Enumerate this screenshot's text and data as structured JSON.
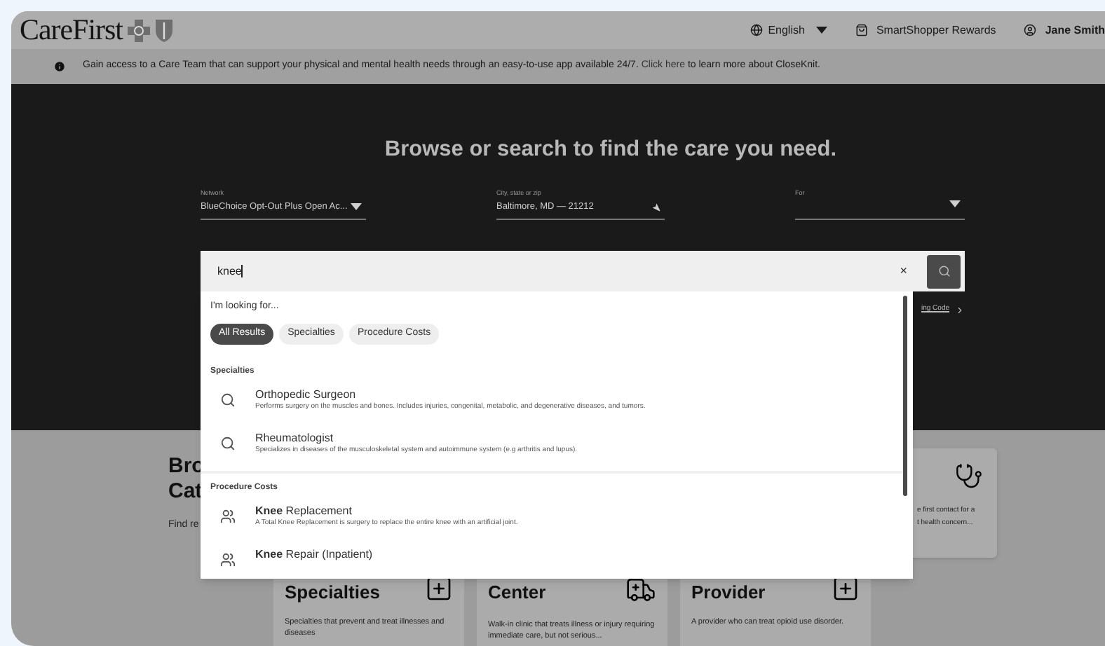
{
  "header": {
    "logo": "CareFirst",
    "language": "English",
    "rewards": "SmartShopper Rewards",
    "user": "Jane Smith"
  },
  "banner": {
    "text": "Gain access to a Care Team that can support your physical and mental health needs through an easy-to-use app available 24/7.",
    "link": "Click here",
    "text_after": "to learn more about CloseKnit."
  },
  "hero": {
    "title": "Browse or search to find the care you need.",
    "fields": [
      {
        "label": "Network",
        "value": "BlueChoice Opt-Out Plus Open Ac...",
        "kind": "dropdown"
      },
      {
        "label": "City, state or zip",
        "value": "Baltimore, MD — 21212",
        "kind": "location"
      },
      {
        "label": "For",
        "kind": "dropdown"
      }
    ],
    "search": {
      "value": "knee",
      "clear": "×"
    },
    "side_link": "ing Code"
  },
  "dropdown": {
    "prompt": "I'm looking for...",
    "filters": [
      {
        "label": "All Results",
        "selected": true
      },
      {
        "label": "Specialties",
        "selected": false
      },
      {
        "label": "Procedure Costs",
        "selected": false
      }
    ],
    "sections": [
      {
        "title": "Specialties",
        "items": [
          {
            "kind": "specialty",
            "title": "Orthopedic Surgeon",
            "description": "Performs surgery on the muscles and bones. Includes injuries, congenital, metabolic, and degenerative diseases, and tumors."
          },
          {
            "kind": "specialty",
            "title": "Rheumatologist",
            "description": "Specializes in diseases of the musculoskeletal system and autoimmune system (e.g arthritis and lupus)."
          }
        ]
      },
      {
        "title": "Procedure Costs",
        "items": [
          {
            "kind": "procedure",
            "title": "**Knee** Replacement",
            "description": "A Total Knee Replacement is surgery to replace the entire knee with an artificial joint."
          },
          {
            "kind": "procedure",
            "title": "**Knee** Repair (Inpatient)"
          }
        ]
      }
    ]
  },
  "browse": {
    "heading_lines": [
      "Bro",
      "Cat"
    ],
    "subtext": "Find re",
    "top_card": {
      "kind": "stethoscope",
      "description_lines": [
        "e first contact for a",
        "t health concern..."
      ]
    },
    "cards": [
      {
        "kind": "plus",
        "title": "Specialties",
        "description": "Specialties that prevent and treat illnesses and diseases"
      },
      {
        "kind": "ambulance",
        "title": "Center",
        "description": "Walk-in clinic that treats illness or injury requiring immediate care, but not serious..."
      },
      {
        "kind": "plus",
        "title": "Provider",
        "description": "A provider who can treat opioid use disorder."
      }
    ]
  }
}
